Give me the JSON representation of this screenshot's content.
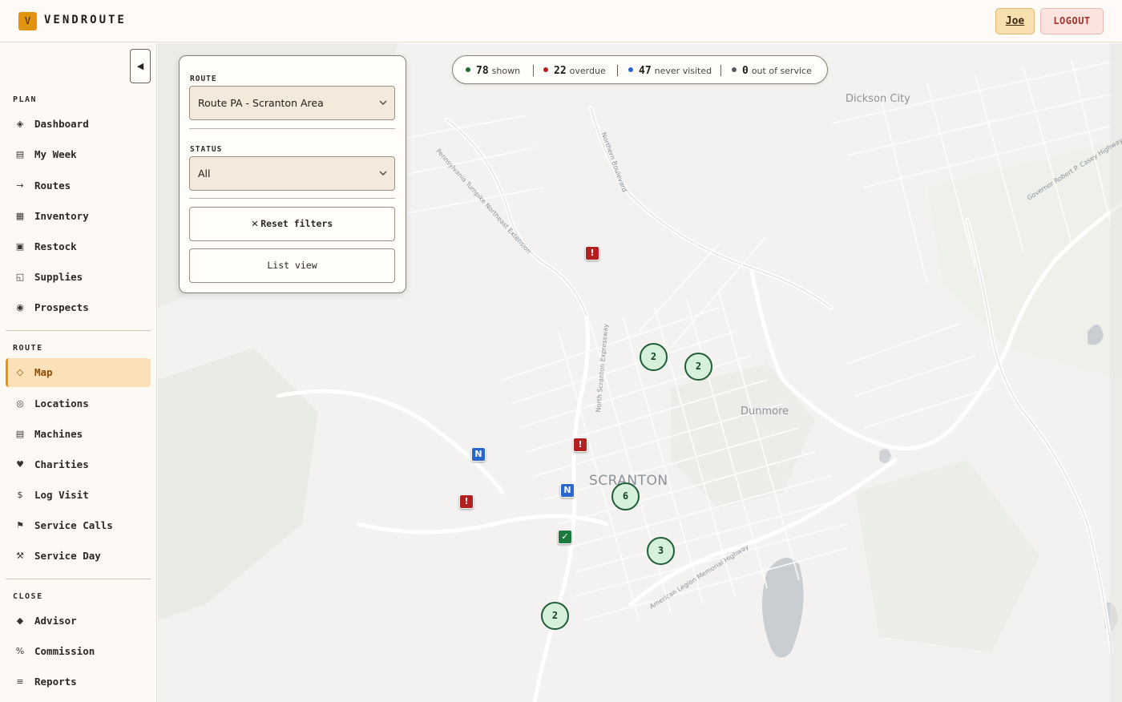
{
  "app": {
    "logo_letter": "V",
    "brand": "VENDROUTE"
  },
  "header": {
    "user_label": "Joe",
    "logout_label": "LOGOUT"
  },
  "sidebar": {
    "collapse_icon": "◀",
    "sections": [
      {
        "label": "PLAN",
        "items": [
          {
            "label": "Dashboard",
            "icon": "◈"
          },
          {
            "label": "My Week",
            "icon": "▤"
          },
          {
            "label": "Routes",
            "icon": "→"
          },
          {
            "label": "Inventory",
            "icon": "▦"
          },
          {
            "label": "Restock",
            "icon": "▣"
          },
          {
            "label": "Supplies",
            "icon": "◱"
          },
          {
            "label": "Prospects",
            "icon": "◉"
          }
        ]
      },
      {
        "label": "ROUTE",
        "items": [
          {
            "label": "Map",
            "icon": "◇",
            "active": true
          },
          {
            "label": "Locations",
            "icon": "◎"
          },
          {
            "label": "Machines",
            "icon": "▤"
          },
          {
            "label": "Charities",
            "icon": "♥"
          },
          {
            "label": "Log Visit",
            "icon": "$"
          },
          {
            "label": "Service Calls",
            "icon": "⚑"
          },
          {
            "label": "Service Day",
            "icon": "⚒"
          }
        ]
      },
      {
        "label": "CLOSE",
        "items": [
          {
            "label": "Advisor",
            "icon": "◆"
          },
          {
            "label": "Commission",
            "icon": "%"
          },
          {
            "label": "Reports",
            "icon": "≡"
          }
        ]
      }
    ]
  },
  "filters": {
    "route_label": "ROUTE",
    "route_value": "Route PA - Scranton Area",
    "status_label": "STATUS",
    "status_value": "All",
    "reset_label": "Reset filters",
    "list_view_label": "List view"
  },
  "stats": [
    {
      "value": "78",
      "label": "shown",
      "color": "#1e6b3a"
    },
    {
      "value": "22",
      "label": "overdue",
      "color": "#b3201f"
    },
    {
      "value": "47",
      "label": "never visited",
      "color": "#2a66d0"
    },
    {
      "value": "0",
      "label": "out of service",
      "color": "#555a60"
    }
  ],
  "map": {
    "place_labels": [
      "Dickson City",
      "Dunmore",
      "SCRANTON"
    ],
    "road_labels": [
      "Pennsylvania Turnpike Northeast Extension",
      "Northern Boulevard",
      "North Scranton Expressway",
      "American Legion Memorial Highway",
      "Governor Robert P. Casey Highway"
    ],
    "clusters": [
      "2",
      "2",
      "6",
      "3",
      "2"
    ],
    "pins": [
      {
        "type": "overdue",
        "glyph": "!"
      },
      {
        "type": "overdue",
        "glyph": "!"
      },
      {
        "type": "overdue",
        "glyph": "!"
      },
      {
        "type": "never",
        "glyph": "N"
      },
      {
        "type": "never",
        "glyph": "N"
      },
      {
        "type": "ok",
        "glyph": "✓"
      }
    ]
  }
}
